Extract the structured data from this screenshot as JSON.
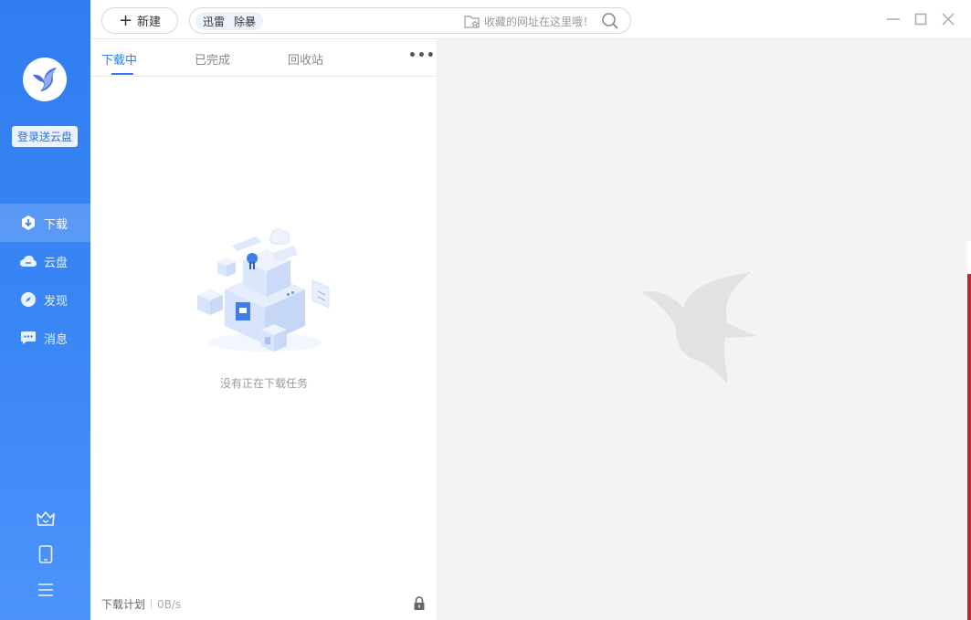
{
  "sidebar": {
    "login_label": "登录送云盘",
    "nav": [
      {
        "label": "下载",
        "icon": "download-icon",
        "active": true
      },
      {
        "label": "云盘",
        "icon": "cloud-icon",
        "active": false
      },
      {
        "label": "发现",
        "icon": "compass-icon",
        "active": false
      },
      {
        "label": "消息",
        "icon": "message-icon",
        "active": false
      }
    ],
    "bottom_icons": [
      "crown-icon",
      "phone-icon",
      "menu-icon"
    ]
  },
  "topbar": {
    "new_label": "新建",
    "search_chips": [
      "迅雷",
      "除暴"
    ],
    "search_placeholder": "收藏的网址在这里哦！"
  },
  "panel": {
    "tabs": [
      "下载中",
      "已完成",
      "回收站"
    ],
    "active_tab": "下载中",
    "empty_text": "没有正在下载任务",
    "footer_plan": "下载计划",
    "footer_speed": "0B/s"
  },
  "colors": {
    "accent": "#2f7df0",
    "sidebar": "#3b86f5"
  }
}
